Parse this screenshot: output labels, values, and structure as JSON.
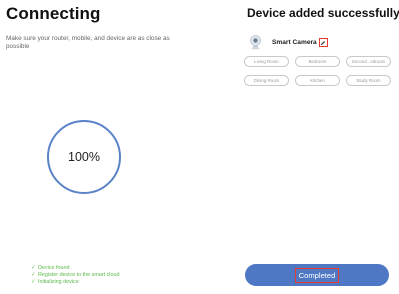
{
  "connecting": {
    "title": "Connecting",
    "subtitle": "Make sure your router, mobile, and device are as close as possible",
    "progress": {
      "value": 1.0,
      "label": "100%"
    },
    "steps": [
      {
        "label": "Device found"
      },
      {
        "label": "Register device to the smart cloud"
      },
      {
        "label": "Initializing device"
      }
    ]
  },
  "success": {
    "title": "Device added successfully",
    "device": {
      "name": "Smart Camera"
    },
    "rooms": [
      "Living Room",
      "Bedroom",
      "Second...edroom",
      "Dining Room",
      "Kitchen",
      "Study Room"
    ],
    "completed_label": "Completed"
  },
  "colors": {
    "ring": "#5b83c8",
    "step_text": "#5cb84a",
    "primary_button": "#4f78c4",
    "highlight_box": "#e63b2e"
  },
  "icons": {
    "device": "camera-icon",
    "edit": "pencil-icon",
    "step": "checkmark-icon"
  }
}
